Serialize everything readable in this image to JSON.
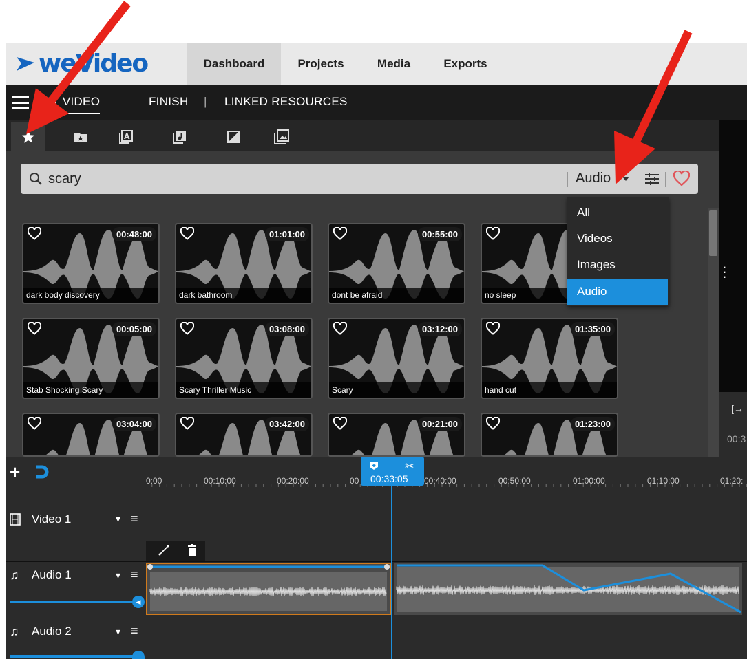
{
  "app": {
    "logo_text": "weVideo"
  },
  "topnav": {
    "items": [
      "Dashboard",
      "Projects",
      "Media",
      "Exports"
    ],
    "active": "Dashboard"
  },
  "subnav": {
    "items": [
      "MY VIDEO",
      "FINISH",
      "LINKED RESOURCES"
    ],
    "separator": "|"
  },
  "library": {
    "tabs": [
      "star-icon",
      "folder-icon",
      "text-icon",
      "music-icon",
      "transition-icon",
      "images-icon"
    ],
    "search": {
      "value": "scary"
    },
    "filter": {
      "selected": "Audio",
      "options": [
        "All",
        "Videos",
        "Images",
        "Audio"
      ]
    },
    "cards": [
      {
        "duration": "00:48:00",
        "title": "dark body discovery"
      },
      {
        "duration": "01:01:00",
        "title": "dark bathroom"
      },
      {
        "duration": "00:55:00",
        "title": "dont be afraid"
      },
      {
        "duration": "",
        "title": "no sleep"
      },
      {
        "duration": "00:05:00",
        "title": "Stab Shocking Scary"
      },
      {
        "duration": "03:08:00",
        "title": "Scary Thriller Music"
      },
      {
        "duration": "03:12:00",
        "title": "Scary"
      },
      {
        "duration": "01:35:00",
        "title": "hand cut"
      },
      {
        "duration": "03:04:00",
        "title": ""
      },
      {
        "duration": "03:42:00",
        "title": ""
      },
      {
        "duration": "00:21:00",
        "title": ""
      },
      {
        "duration": "01:23:00",
        "title": ""
      }
    ]
  },
  "preview": {
    "time_partial": "00:3"
  },
  "timeline": {
    "playhead_time": "00:33:05",
    "ruler_ticks": [
      "0:00",
      "00:10:00",
      "00:20:00",
      "00",
      "00:40:00",
      "00:50:00",
      "01:00:00",
      "01:10:00",
      "01:20:"
    ],
    "tracks": [
      {
        "name": "Video 1",
        "type": "video"
      },
      {
        "name": "Audio 1",
        "type": "audio"
      },
      {
        "name": "Audio 2",
        "type": "audio"
      }
    ]
  },
  "colors": {
    "accent": "#1c8fdc",
    "arrow": "#e8231a",
    "favorite": "#e0555a"
  }
}
